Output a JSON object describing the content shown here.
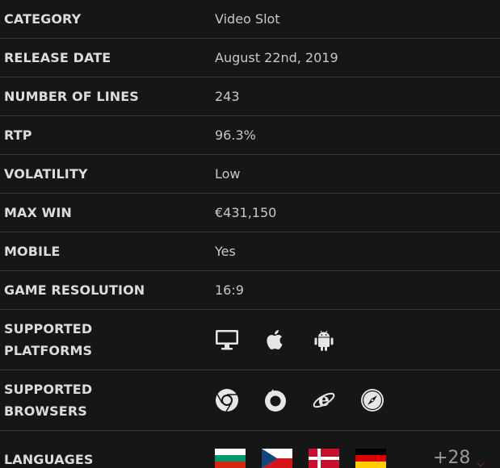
{
  "rows": [
    {
      "label": "CATEGORY",
      "value": "Video Slot"
    },
    {
      "label": "RELEASE DATE",
      "value": "August 22nd, 2019"
    },
    {
      "label": "NUMBER OF LINES",
      "value": "243"
    },
    {
      "label": "RTP",
      "value": "96.3%"
    },
    {
      "label": "VOLATILITY",
      "value": "Low"
    },
    {
      "label": "MAX WIN",
      "value": "€431,150"
    },
    {
      "label": "MOBILE",
      "value": "Yes"
    },
    {
      "label": "GAME RESOLUTION",
      "value": "16:9"
    }
  ],
  "platforms": {
    "label_line1": "SUPPORTED",
    "label_line2": "PLATFORMS",
    "icons": [
      "desktop-icon",
      "apple-icon",
      "android-icon"
    ]
  },
  "browsers": {
    "label_line1": "SUPPORTED",
    "label_line2": "BROWSERS",
    "icons": [
      "chrome-icon",
      "firefox-icon",
      "internet-explorer-icon",
      "safari-icon"
    ]
  },
  "languages": {
    "label": "LANGUAGES",
    "flags": [
      "bulgaria-flag",
      "czech-flag",
      "denmark-flag",
      "germany-flag"
    ],
    "more_count": "+28",
    "more_icon": "chevron-down-icon"
  },
  "colors": {
    "background": "#161616",
    "divider": "#3a3a3a",
    "accent": "#d33a2a"
  }
}
